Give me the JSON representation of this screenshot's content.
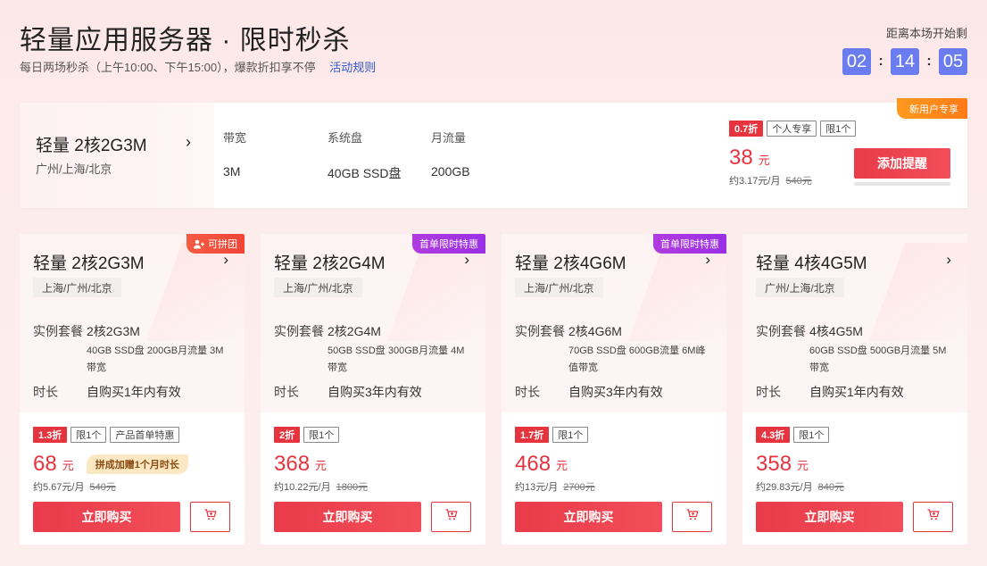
{
  "header": {
    "title": "轻量应用服务器 · 限时秒杀",
    "subtitle": "每日两场秒杀（上午10:00、下午15:00），爆款折扣享不停",
    "rules_link": "活动规则",
    "countdown_label": "距离本场开始剩",
    "countdown": {
      "hours": "02",
      "minutes": "14",
      "seconds": "05",
      "sep": ":"
    }
  },
  "featured": {
    "name": "轻量 2核2G3M",
    "region": "广州/上海/北京",
    "specs": [
      {
        "key": "带宽",
        "value": "3M"
      },
      {
        "key": "系统盘",
        "value": "40GB SSD盘"
      },
      {
        "key": "月流量",
        "value": "200GB"
      }
    ],
    "tags": [
      "0.7折",
      "个人专享",
      "限1个"
    ],
    "price": "38",
    "unit": "元",
    "monthly": "约3.17元/月",
    "original": "540元",
    "button": "添加提醒",
    "corner_badge": "新用户专享"
  },
  "cards": [
    {
      "name": "轻量 2核2G3M",
      "region": "上海/广州/北京",
      "badge": "可拼团",
      "badge_type": "orange",
      "plan_label": "实例套餐",
      "plan": "2核2G3M",
      "detail": "40GB SSD盘 200GB月流量 3M带宽",
      "duration_label": "时长",
      "duration": "自购买1年内有效",
      "tags": [
        "1.3折",
        "限1个",
        "产品首单特惠"
      ],
      "price": "68",
      "unit": "元",
      "promo": "拼成加赠1个月时长",
      "monthly": "约5.67元/月",
      "original": "540元",
      "buy": "立即购买"
    },
    {
      "name": "轻量 2核2G4M",
      "region": "上海/广州/北京",
      "badge": "首单限时特惠",
      "badge_type": "purple",
      "plan_label": "实例套餐",
      "plan": "2核2G4M",
      "detail": "50GB SSD盘 300GB月流量 4M带宽",
      "duration_label": "时长",
      "duration": "自购买3年内有效",
      "tags": [
        "2折",
        "限1个"
      ],
      "price": "368",
      "unit": "元",
      "promo": "",
      "monthly": "约10.22元/月",
      "original": "1800元",
      "buy": "立即购买"
    },
    {
      "name": "轻量 2核4G6M",
      "region": "上海/广州/北京",
      "badge": "首单限时特惠",
      "badge_type": "purple",
      "plan_label": "实例套餐",
      "plan": "2核4G6M",
      "detail": "70GB SSD盘 600GB流量 6M峰值带宽",
      "duration_label": "时长",
      "duration": "自购买3年内有效",
      "tags": [
        "1.7折",
        "限1个"
      ],
      "price": "468",
      "unit": "元",
      "promo": "",
      "monthly": "约13元/月",
      "original": "2700元",
      "buy": "立即购买"
    },
    {
      "name": "轻量 4核4G5M",
      "region": "广州/上海/北京",
      "badge": "",
      "badge_type": "",
      "plan_label": "实例套餐",
      "plan": "4核4G5M",
      "detail": "60GB SSD盘 500GB月流量 5M带宽",
      "duration_label": "时长",
      "duration": "自购买1年内有效",
      "tags": [
        "4.3折",
        "限1个"
      ],
      "price": "358",
      "unit": "元",
      "promo": "",
      "monthly": "约29.83元/月",
      "original": "840元",
      "buy": "立即购买"
    }
  ],
  "colors": {
    "accent": "#e6343e",
    "countdown": "#6b7cf0",
    "link": "#2f56c9"
  }
}
